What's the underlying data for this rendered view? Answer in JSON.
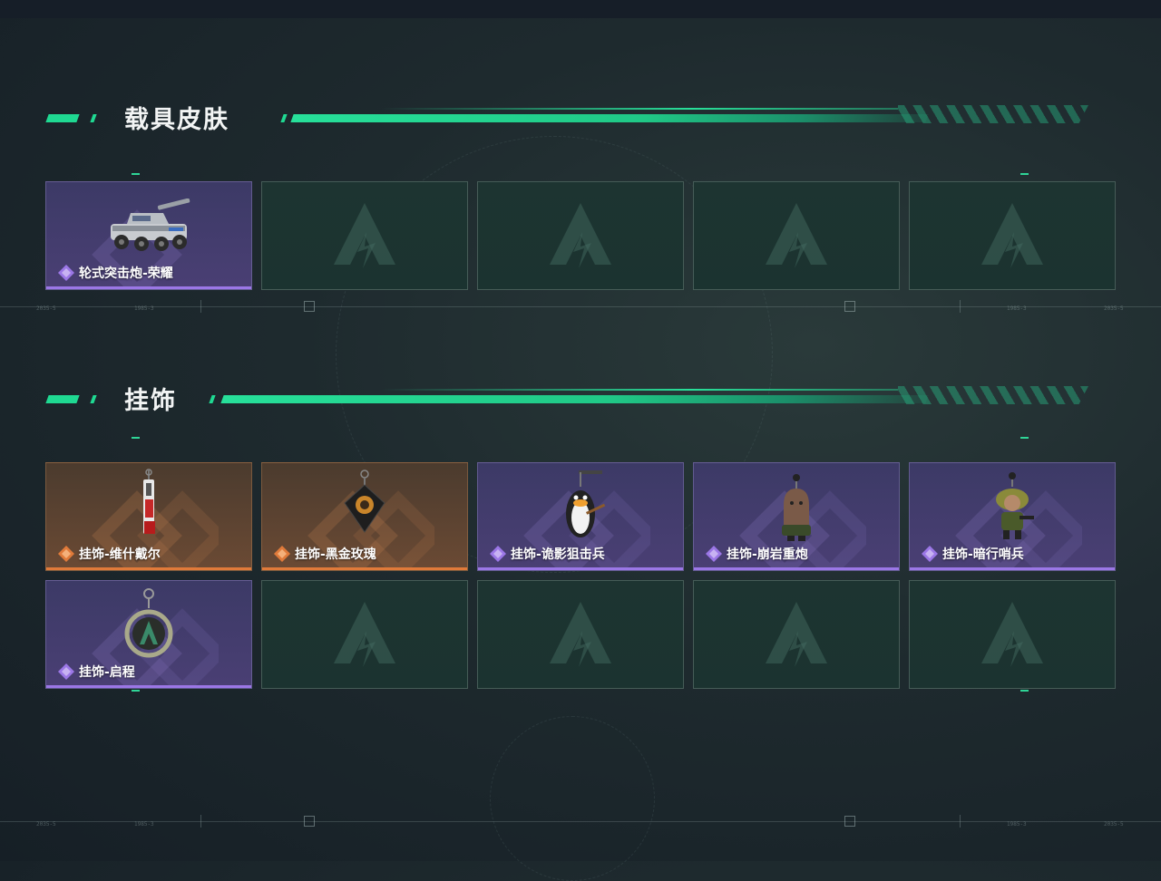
{
  "sections": [
    {
      "title": "载具皮肤",
      "items": [
        {
          "label": "轮式突击炮-荣耀",
          "rarity": "purple",
          "art": "tank"
        },
        {
          "label": "",
          "rarity": "empty"
        },
        {
          "label": "",
          "rarity": "empty"
        },
        {
          "label": "",
          "rarity": "empty"
        },
        {
          "label": "",
          "rarity": "empty"
        }
      ]
    },
    {
      "title": "挂饰",
      "items": [
        {
          "label": "挂饰-维什戴尔",
          "rarity": "orange",
          "art": "charm-tall"
        },
        {
          "label": "挂饰-黑金玫瑰",
          "rarity": "orange",
          "art": "charm-rose"
        },
        {
          "label": "挂饰-诡影狙击兵",
          "rarity": "purple",
          "art": "charm-penguin"
        },
        {
          "label": "挂饰-崩岩重炮",
          "rarity": "purple",
          "art": "charm-rock"
        },
        {
          "label": "挂饰-暗行哨兵",
          "rarity": "purple",
          "art": "charm-sentinel"
        },
        {
          "label": "挂饰-启程",
          "rarity": "purple",
          "art": "charm-ring"
        },
        {
          "label": "",
          "rarity": "empty"
        },
        {
          "label": "",
          "rarity": "empty"
        },
        {
          "label": "",
          "rarity": "empty"
        },
        {
          "label": "",
          "rarity": "empty"
        }
      ]
    }
  ],
  "colors": {
    "accent": "#1fd992",
    "purple_rarity": "#9b77e6",
    "orange_rarity": "#e07a3a"
  },
  "deco_text": {
    "code_a": "2035-5",
    "code_b": "1985-3"
  }
}
